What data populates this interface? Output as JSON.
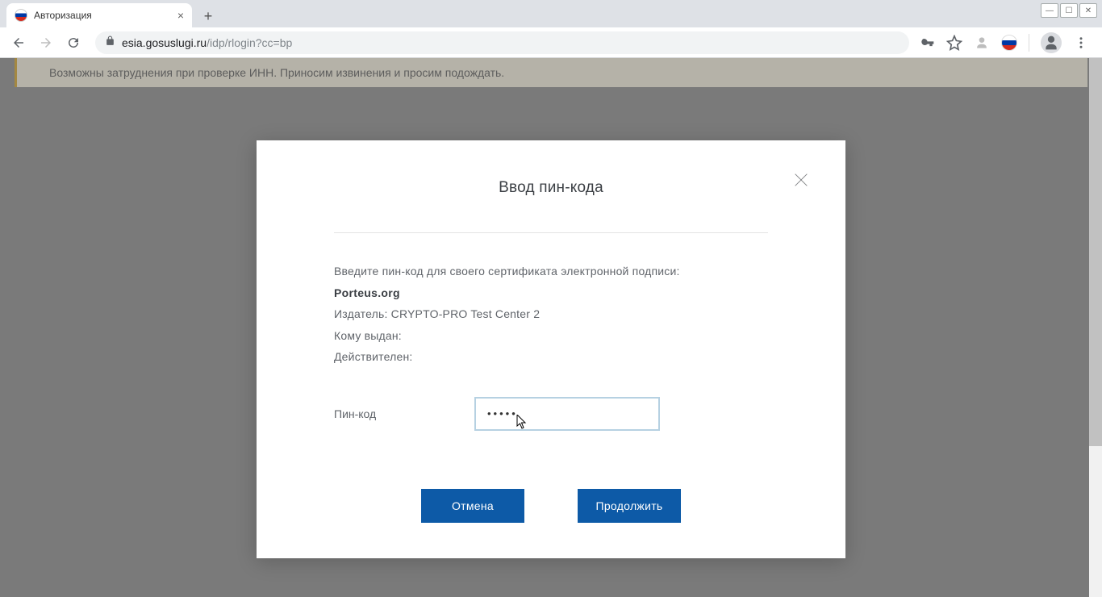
{
  "browser": {
    "tab_title": "Авторизация",
    "url_host": "esia.gosuslugi.ru",
    "url_path": "/idp/rlogin?cc=bp"
  },
  "page": {
    "notice": "Возможны затруднения при проверке ИНН. Приносим извинения и просим подождать."
  },
  "dialog": {
    "title": "Ввод пин-кода",
    "instruction": "Введите пин-код для своего сертификата электронной подписи:",
    "cert_name": "Porteus.org",
    "issuer_label": "Издатель:",
    "issuer_value": "CRYPTO-PRO Test Center 2",
    "subject_label": "Кому выдан:",
    "subject_value": "",
    "valid_label": "Действителен:",
    "valid_value": "",
    "pin_label": "Пин-код",
    "pin_value": "•••••",
    "cancel": "Отмена",
    "continue": "Продолжить"
  }
}
